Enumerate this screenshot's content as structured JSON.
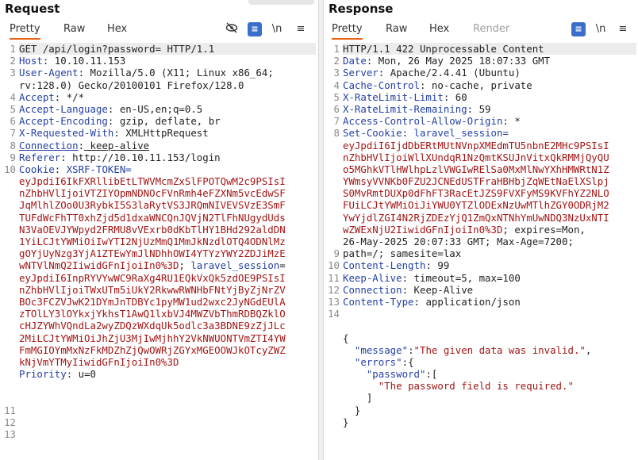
{
  "request": {
    "title": "Request",
    "tabs": [
      "Pretty",
      "Raw",
      "Hex"
    ],
    "active_tab": "Pretty",
    "tools": {
      "wrap": "≡",
      "newline": "\\n",
      "menu": "≡"
    },
    "gutter": [
      "1",
      "2",
      "3",
      "",
      "4",
      "5",
      "6",
      "7",
      "8",
      "9",
      "10",
      "",
      "",
      "",
      "",
      "",
      "",
      "",
      "",
      "",
      "",
      "",
      "",
      "",
      "",
      "",
      "",
      "",
      "",
      "",
      "11",
      "12",
      "13"
    ],
    "lines": [
      {
        "k": "",
        "t": "GET /api/login?password= HTTP/1.1"
      },
      {
        "k": "Host",
        "t": " 10.10.11.153"
      },
      {
        "k": "User-Agent",
        "t": " Mozilla/5.0 (X11; Linux x86_64;"
      },
      {
        "k": "",
        "t": "rv:128.0) Gecko/20100101 Firefox/128.0"
      },
      {
        "k": "Accept",
        "t": " */*"
      },
      {
        "k": "Accept-Language",
        "t": " en-US,en;q=0.5"
      },
      {
        "k": "Accept-Encoding",
        "t": " gzip, deflate, br"
      },
      {
        "k": "X-Requested-With",
        "t": " XMLHttpRequest"
      },
      {
        "k": "Connection",
        "t": " keep-alive"
      },
      {
        "k": "Referer",
        "t": " http://10.10.11.153/login"
      },
      {
        "k": "Cookie",
        "t": " XSRF-TOKEN="
      },
      {
        "k": "",
        "r": "eyJpdiI6IkFXRllibEtLTWVMcmZxSlFPOTQwM2c9PSIsI"
      },
      {
        "k": "",
        "r": "nZhbHVlIjoiVTZIYOpmNDNOcFVnRmh4eFZXNm5vcEdwSF"
      },
      {
        "k": "",
        "r": "JqMlhlZOo0U3RybkI5S3laRytVS3JRQmNIVEVSVzE3SmF"
      },
      {
        "k": "",
        "r": "TUFdWcFhTT0xhZjd5d1dxaWNCQnJQVjN2TlFhNUgydUds"
      },
      {
        "k": "",
        "r": "N3VaOEVJYWpyd2FRMU8vVExrb0dKbTlHY1BHd292aldDN"
      },
      {
        "k": "",
        "r": "1YiLCJtYWMiOiIwYTI2NjUzMmQ1MmJkNzdlOTQ4ODNlMz"
      },
      {
        "k": "",
        "r": "gOYjUyNzg3YjA1ZTEwYmJlNDhhOWI4YTYzYWY2ZDJiMzE"
      },
      {
        "k": "",
        "r": "wNTVlNmQ2IiwidGFnIjoiIn0%3D",
        "t2": "; ",
        "b": "laravel_session",
        "t3": "="
      },
      {
        "k": "",
        "r": "eyJpdiI6InpRYVYwWC9RaXg4RU1EQkVxQk5zdOE9PSIsI"
      },
      {
        "k": "",
        "r": "nZhbHVlIjoiTWxUTm5iUkY2RkwwRWNHbFNtYjByZjNrZV"
      },
      {
        "k": "",
        "r": "BOc3FCZVJwK21DYmJnTDBYc1pyMW1ud2wxc2JyNGdEUlA"
      },
      {
        "k": "",
        "r": "zTOlLY3lOYkxjYkhsT1AwQ1lxbVJ4MWZVbThmRDBQZklO"
      },
      {
        "k": "",
        "r": "cHJZYWhVQndLa2wyZDQzWXdqUk5odlc3a3BDNE9zZjJLc"
      },
      {
        "k": "",
        "r": "2MiLCJtYWMiOiJhZjU3MjIwMjhhY2VkNWUONTVmZTI4YW"
      },
      {
        "k": "",
        "r": "FmMGIOYmMxNzFkMDZhZjQwOWRjZGYxMGEOOWJkOTcyZWZ"
      },
      {
        "k": "",
        "r": "kNjVmYTMyIiwidGFnIjoiIn0%3D"
      },
      {
        "k": "Priority",
        "t": " u=0"
      },
      {
        "k": "",
        "t": ""
      },
      {
        "k": "",
        "t": ""
      }
    ]
  },
  "response": {
    "title": "Response",
    "tabs": [
      "Pretty",
      "Raw",
      "Hex",
      "Render"
    ],
    "active_tab": "Pretty",
    "tools": {
      "wrap": "≡",
      "newline": "\\n",
      "menu": "≡"
    },
    "gutter": [
      "1",
      "2",
      "3",
      "4",
      "5",
      "6",
      "7",
      "8",
      "",
      "",
      "",
      "",
      "",
      "",
      "",
      "",
      "",
      "9",
      "10",
      "11",
      "12",
      "13",
      "14",
      "",
      "",
      "",
      "",
      "",
      ""
    ],
    "status_line": "HTTP/1.1 422 Unprocessable Content",
    "headers": [
      {
        "k": "Date",
        "t": " Mon, 26 May 2025 18:07:33 GMT"
      },
      {
        "k": "Server",
        "t": " Apache/2.4.41 (Ubuntu)"
      },
      {
        "k": "Cache-Control",
        "t": " no-cache, private"
      },
      {
        "k": "X-RateLimit-Limit",
        "t": " 60"
      },
      {
        "k": "X-RateLimit-Remaining",
        "t": " 59"
      },
      {
        "k": "Access-Control-Allow-Origin",
        "t": " *"
      },
      {
        "k": "Set-Cookie",
        "t": " laravel_session="
      }
    ],
    "cookie_lines": [
      "eyJpdiI6IjdDbERtMUtNVnpXMEdmTU5nbnE2MHc9PSIsI",
      "nZhbHVlIjoiWllXUndqR1NzQmtKSUJnVitxQkRMMjQyQU",
      "o5MGhkVTlHWlhpLzlVWGIwRElSa0MxMlNwYXhHMWRtN1Z",
      "YWmsyVVNKb0FZU2JCNEdUSTFraHBHbjZqWEtNaElXSlpj",
      "S0MvRmtDUXp0dFhFT3RacEtJZS9FVXFyMS9KVFhYZ2NLO",
      "FUiLCJtYWMiOiJiYWU0YTZlODExNzUwMTlhZGY0ODRjM2",
      "YwYjdlZGI4N2RjZDEzYjQ1ZmQxNTNhYmUwNDQ3NzUxNTI",
      "wZWExNjU2IiwidGFnIjoiIn0%3D"
    ],
    "cookie_tail": "; expires=Mon,",
    "cookie_more": [
      "26-May-2025 20:07:33 GMT; Max-Age=7200;",
      "path=/; samesite=lax"
    ],
    "headers2": [
      {
        "k": "Content-Length",
        "t": " 99"
      },
      {
        "k": "Keep-Alive",
        "t": " timeout=5, max=100"
      },
      {
        "k": "Connection",
        "t": " Keep-Alive"
      },
      {
        "k": "Content-Type",
        "t": " application/json"
      }
    ],
    "json": {
      "open": "{",
      "message_key": "\"message\"",
      "message_val": "\"The given data was invalid.\"",
      "errors_key": "\"errors\"",
      "password_key": "\"password\"",
      "password_val": "\"The password field is required.\"",
      "bracket_close": "]",
      "inner_close": "}",
      "close": "}"
    }
  }
}
